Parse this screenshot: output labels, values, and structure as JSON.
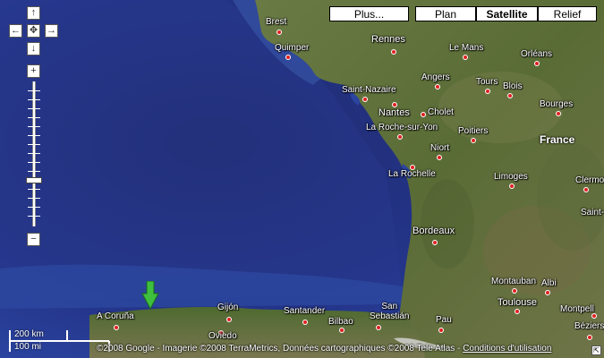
{
  "map_types": {
    "more": "Plus...",
    "plan": "Plan",
    "satellite": "Satellite",
    "relief": "Relief",
    "selected": "Satellite"
  },
  "nav": {
    "up": "↑",
    "left": "←",
    "center": "✥",
    "right": "→",
    "down": "↓",
    "zoom_in": "+",
    "zoom_out": "−"
  },
  "cities": {
    "brest": "Brest",
    "quimper": "Quimper",
    "rennes": "Rennes",
    "le_mans": "Le Mans",
    "orleans": "Orléans",
    "angers": "Angers",
    "saint_nazaire": "Saint-Nazaire",
    "tours": "Tours",
    "blois": "Blois",
    "nantes": "Nantes",
    "cholet": "Cholet",
    "bourges": "Bourges",
    "la_roche": "La Roche-sur-Yon",
    "poitiers": "Poitiers",
    "niort": "Niort",
    "la_rochelle": "La Rochelle",
    "limoges": "Limoges",
    "clermont": "Clermont-Fer",
    "saint_e": "Saint-",
    "bordeaux": "Bordeaux",
    "montauban": "Montauban",
    "albi": "Albi",
    "toulouse": "Toulouse",
    "montpellier": "Montpell",
    "beziers": "Béziers",
    "a_coruna": "A Coruña",
    "gijon": "Gijón",
    "oviedo": "Oviedo",
    "santander": "Santander",
    "bilbao": "Bilbao",
    "san_sebastian": "San\nSebastián",
    "pau": "Pau"
  },
  "country": "France",
  "scale": {
    "km": "200 km",
    "mi": "100 mi"
  },
  "copyright": "©2008 Google - Imagerie ©2008 TerraMetrics, Données cartographiques ©2008 Tele Atlas - ",
  "terms_link": "Conditions d'utilisation",
  "colors": {
    "ocean": "#22307a",
    "land": "#5d6f3a",
    "marker": "#3fbf3f"
  },
  "icons": {
    "marker": "green-arrow-marker",
    "corner": "resize-corner-icon"
  }
}
